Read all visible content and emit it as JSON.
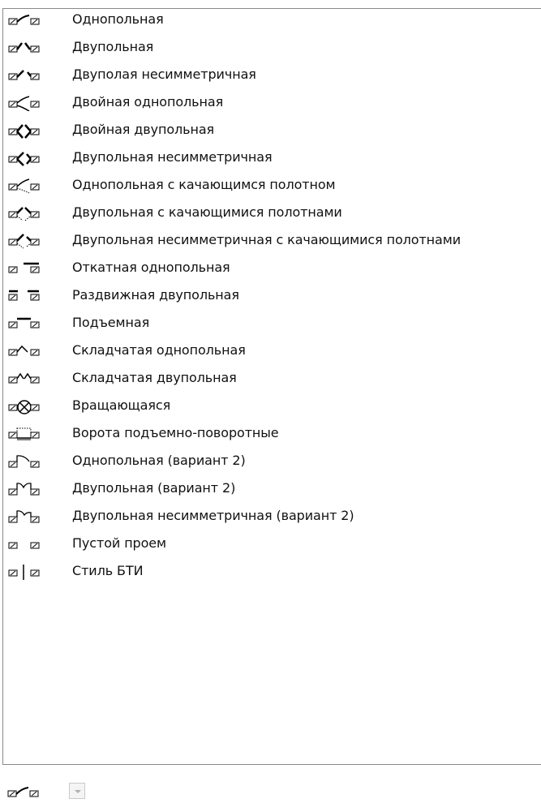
{
  "items": [
    {
      "label": "Однопольная",
      "icon": "door-single-icon"
    },
    {
      "label": "Двупольная",
      "icon": "door-double-icon"
    },
    {
      "label": "Двуполая несимметричная",
      "icon": "door-double-asymmetric-icon"
    },
    {
      "label": "Двойная однопольная",
      "icon": "door-double-single-icon"
    },
    {
      "label": "Двойная двупольная",
      "icon": "door-double-double-icon"
    },
    {
      "label": "Двупольная несимметричная",
      "icon": "door-double-asymmetric-2-icon"
    },
    {
      "label": "Однопольная с качающимся полотном",
      "icon": "door-single-swing-icon"
    },
    {
      "label": "Двупольная с качающимися полотнами",
      "icon": "door-double-swing-icon"
    },
    {
      "label": "Двупольная несимметричная с качающимися полотнами",
      "icon": "door-double-asymmetric-swing-icon"
    },
    {
      "label": "Откатная однопольная",
      "icon": "door-sliding-single-icon"
    },
    {
      "label": "Раздвижная двупольная",
      "icon": "door-sliding-double-icon"
    },
    {
      "label": "Подъемная",
      "icon": "door-lifting-icon"
    },
    {
      "label": "Складчатая однопольная",
      "icon": "door-folding-single-icon"
    },
    {
      "label": "Складчатая двупольная",
      "icon": "door-folding-double-icon"
    },
    {
      "label": "Вращающаяся",
      "icon": "door-revolving-icon"
    },
    {
      "label": "Ворота подъемно-поворотные",
      "icon": "gate-lift-swing-icon"
    },
    {
      "label": "Однопольная (вариант 2)",
      "icon": "door-single-v2-icon"
    },
    {
      "label": "Двупольная (вариант 2)",
      "icon": "door-double-v2-icon"
    },
    {
      "label": "Двупольная несимметричная (вариант 2)",
      "icon": "door-double-asymmetric-v2-icon"
    },
    {
      "label": "Пустой проем",
      "icon": "empty-opening-icon"
    },
    {
      "label": "Стиль БТИ",
      "icon": "bti-style-icon"
    }
  ],
  "selected": {
    "icon": "door-single-icon"
  }
}
